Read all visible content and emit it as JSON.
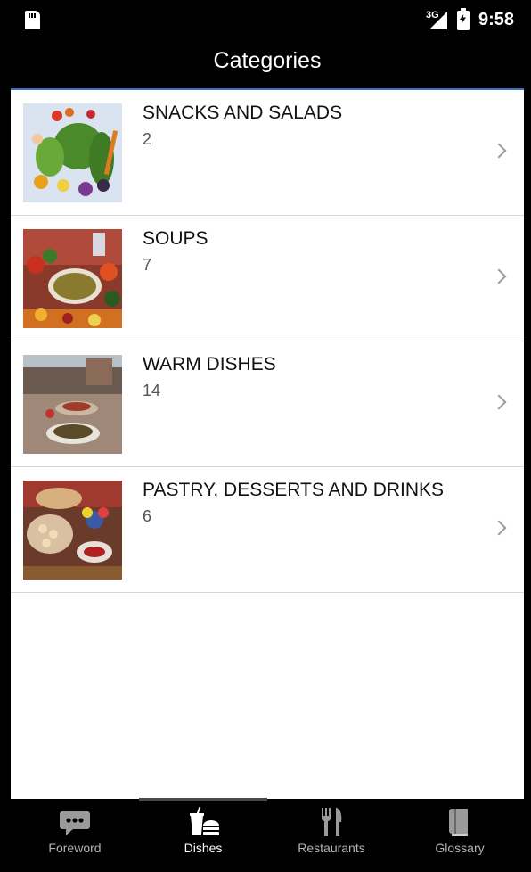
{
  "status_bar": {
    "network": "3G",
    "time": "9:58"
  },
  "header": {
    "title": "Categories"
  },
  "categories": [
    {
      "name": "SNACKS AND SALADS",
      "count": "2"
    },
    {
      "name": "SOUPS",
      "count": "7"
    },
    {
      "name": "WARM DISHES",
      "count": "14"
    },
    {
      "name": "PASTRY, DESSERTS AND DRINKS",
      "count": "6"
    }
  ],
  "bottom_nav": {
    "active": "Dishes",
    "tabs": [
      {
        "label": "Foreword",
        "icon": "speech-bubble-icon"
      },
      {
        "label": "Dishes",
        "icon": "drink-and-food-icon"
      },
      {
        "label": "Restaurants",
        "icon": "fork-and-knife-icon"
      },
      {
        "label": "Glossary",
        "icon": "book-icon"
      }
    ]
  },
  "colors": {
    "background": "#000000",
    "list_background": "#ffffff",
    "accent_line": "#3b6fc1",
    "divider": "#d6d6d6"
  }
}
